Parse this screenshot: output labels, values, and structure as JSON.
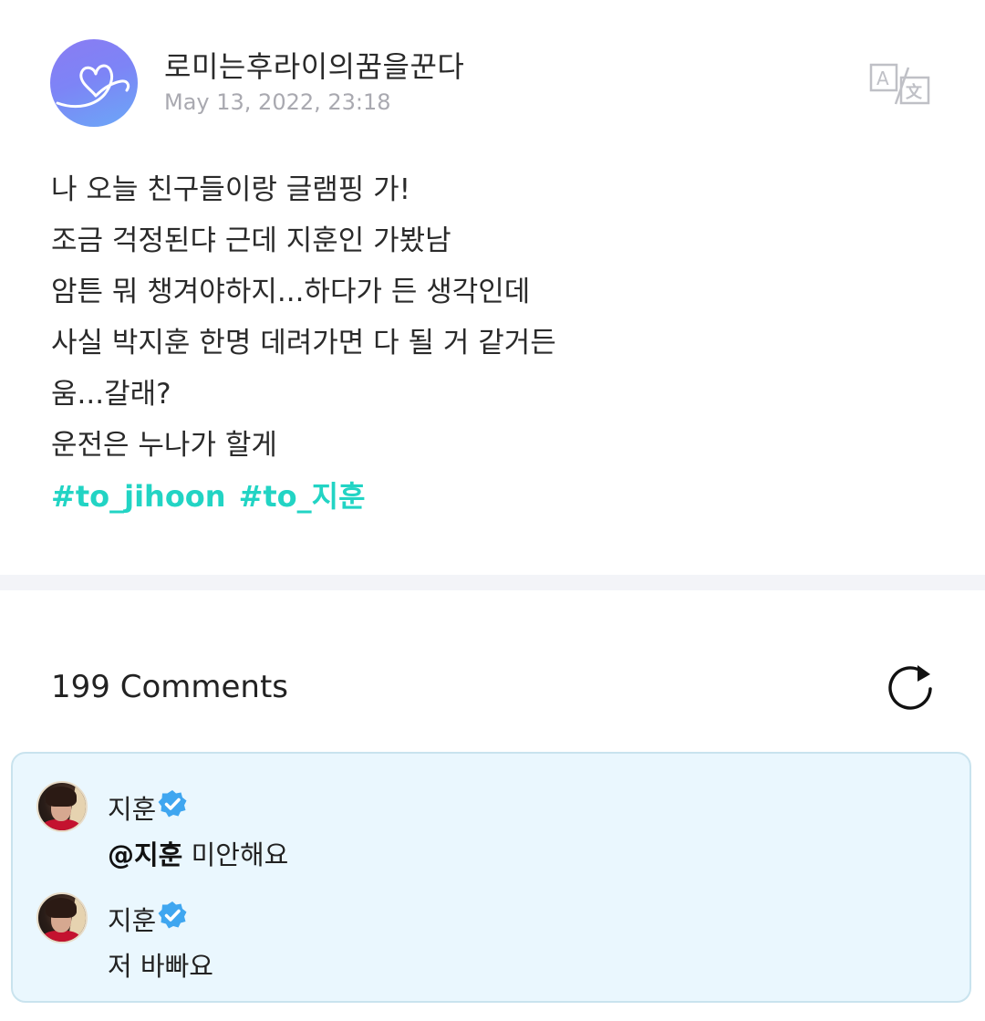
{
  "post": {
    "author": "로미는후라이의꿈을꾼다",
    "date": "May 13, 2022, 23:18",
    "icons": {
      "avatar": "heart-doodle-avatar",
      "translate": "translate-icon"
    },
    "lines": [
      "나 오늘 친구들이랑 글램핑 가!",
      "조금 걱정된댜 근데 지훈인 가봤남",
      "암튼 뭐 챙겨야하지...하다가 든 생각인데",
      "사실 박지훈 한명 데려가면 다 될 거 같거든",
      "움...갈래?",
      "운전은 누나가 할게"
    ],
    "hashtags": [
      "#to_jihoon",
      "#to_지훈"
    ]
  },
  "comments": {
    "title": "199 Comments",
    "refresh_icon": "refresh-icon",
    "items": [
      {
        "author": "지훈",
        "verified": true,
        "mention": "@지훈",
        "text": " 미안해요"
      },
      {
        "author": "지훈",
        "verified": true,
        "mention": "",
        "text": "저 바빠요"
      }
    ]
  },
  "colors": {
    "hashtag": "#22d4c4",
    "comment_panel_bg": "#eaf7fe",
    "comment_panel_border": "#c9e3ee",
    "verified_badge": "#3fa6f0",
    "date_gray": "#a9a9b0",
    "divider": "#f3f4f8"
  }
}
